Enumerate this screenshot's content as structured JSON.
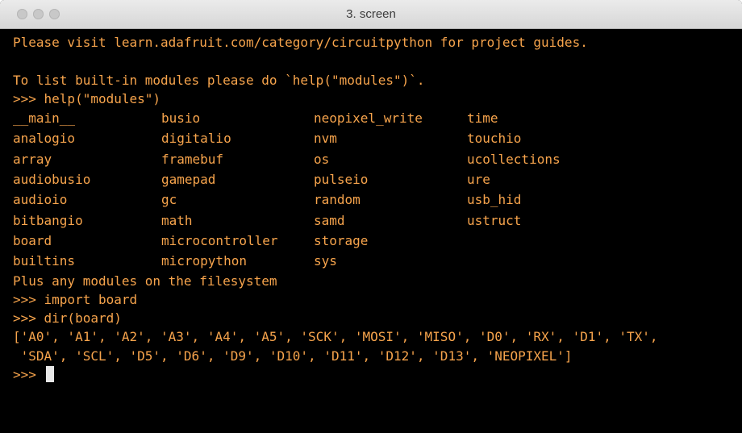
{
  "window": {
    "title": "3. screen"
  },
  "terminal": {
    "line_visit": "Please visit learn.adafruit.com/category/circuitpython for project guides.",
    "line_list": "To list built-in modules please do `help(\"modules\")`.",
    "line_help_cmd": ">>> help(\"modules\")",
    "modules": [
      [
        "__main__",
        "busio",
        "neopixel_write",
        "time"
      ],
      [
        "analogio",
        "digitalio",
        "nvm",
        "touchio"
      ],
      [
        "array",
        "framebuf",
        "os",
        "ucollections"
      ],
      [
        "audiobusio",
        "gamepad",
        "pulseio",
        "ure"
      ],
      [
        "audioio",
        "gc",
        "random",
        "usb_hid"
      ],
      [
        "bitbangio",
        "math",
        "samd",
        "ustruct"
      ],
      [
        "board",
        "microcontroller",
        "storage",
        ""
      ],
      [
        "builtins",
        "micropython",
        "sys",
        ""
      ]
    ],
    "line_plus": "Plus any modules on the filesystem",
    "line_import": ">>> import board",
    "line_dir": ">>> dir(board)",
    "line_out1": "['A0', 'A1', 'A2', 'A3', 'A4', 'A5', 'SCK', 'MOSI', 'MISO', 'D0', 'RX', 'D1', 'TX',",
    "line_out2": " 'SDA', 'SCL', 'D5', 'D6', 'D9', 'D10', 'D11', 'D12', 'D13', 'NEOPIXEL']",
    "prompt": ">>> "
  },
  "colors": {
    "terminal_text": "#f7a44c",
    "terminal_bg": "#000000",
    "cursor": "#e8e8e8"
  }
}
